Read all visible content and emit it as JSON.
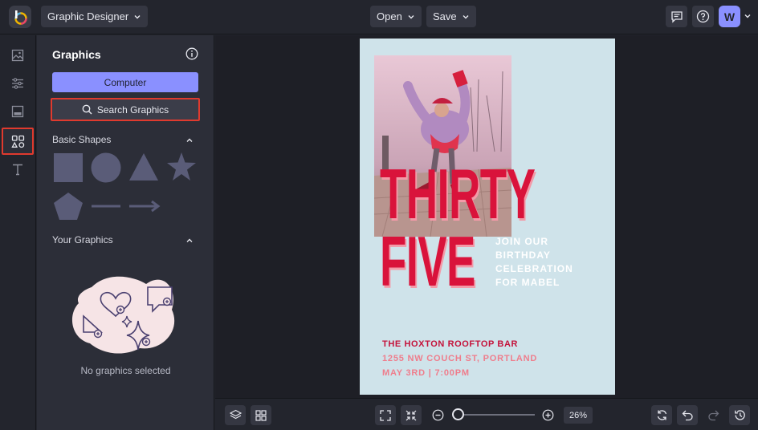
{
  "topbar": {
    "app_logo": "befunky-logo",
    "mode_label": "Graphic Designer",
    "open_label": "Open",
    "save_label": "Save",
    "avatar_initial": "W"
  },
  "rail": {
    "items": [
      {
        "icon": "image-icon"
      },
      {
        "icon": "sliders-icon"
      },
      {
        "icon": "layout-icon"
      },
      {
        "icon": "graphics-icon",
        "active": true
      },
      {
        "icon": "text-icon"
      }
    ]
  },
  "panel": {
    "title": "Graphics",
    "computer_label": "Computer",
    "search_label": "Search Graphics",
    "basic_shapes_label": "Basic Shapes",
    "your_graphics_label": "Your Graphics",
    "empty_label": "No graphics selected"
  },
  "poster": {
    "word1": "THIRTY",
    "word2": "FIVE",
    "invite_lines": [
      "JOIN OUR",
      "BIRTHDAY",
      "CELEBRATION",
      "FOR MABEL"
    ],
    "venue": "THE HOXTON ROOFTOP BAR",
    "address": "1255 NW COUCH ST, PORTLAND",
    "date": "MAY 3RD | 7:00PM"
  },
  "bottombar": {
    "zoom_label": "26%",
    "zoom_level": 0.26
  },
  "colors": {
    "accent": "#8a90ff",
    "highlight": "#e03a2e",
    "poster_bg": "#cfe3ea",
    "poster_red": "#d9133b"
  }
}
